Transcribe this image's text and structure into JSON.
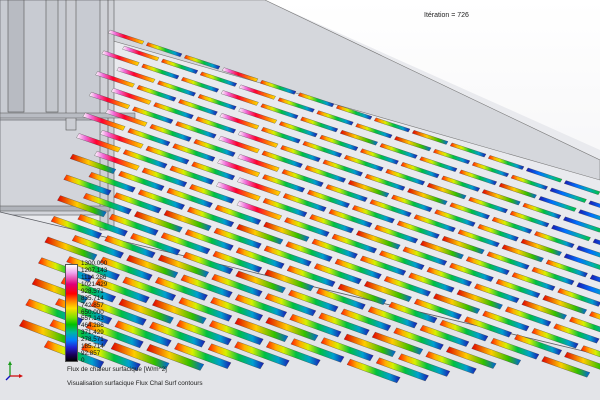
{
  "iteration_label": "Itération = 726",
  "legend": {
    "values": [
      "1300.000",
      "1207.143",
      "1114.286",
      "1021.429",
      "928.571",
      "835.714",
      "742.857",
      "650.000",
      "557.143",
      "464.286",
      "371.429",
      "278.571",
      "185.714",
      "92.857",
      "0"
    ],
    "colors": {
      "max": "#ffffff",
      "high": "#e0007a",
      "mid_high": "#ff0000",
      "mid": "#ffe000",
      "mid_low": "#00c000",
      "low": "#0080ff",
      "min": "#000000"
    }
  },
  "captions": {
    "quantity": "Flux de chaleur surfacique [W/m^2]",
    "plot_name": "Visualisation surfacique Flux Chal Surf contours"
  },
  "icons": {
    "triad": "xyz-triad-icon"
  }
}
